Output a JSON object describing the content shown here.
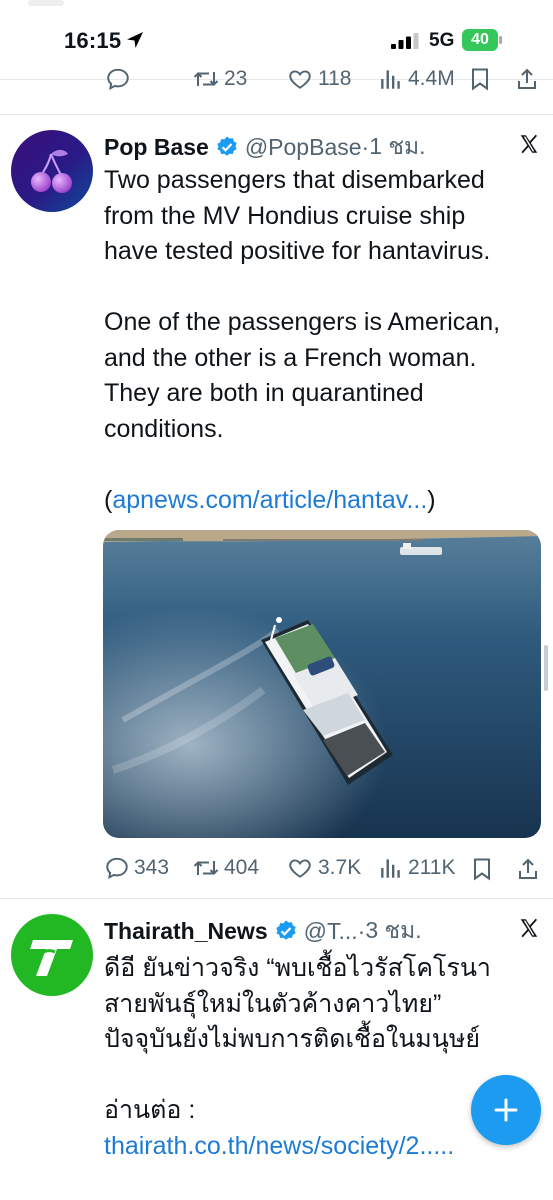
{
  "status_bar": {
    "time": "16:15",
    "network": "5G",
    "battery": "40"
  },
  "prev_tweet_actions": {
    "reposts": "23",
    "likes": "118",
    "views": "4.4M"
  },
  "tweets": [
    {
      "name": "Pop Base",
      "handle": "@PopBase",
      "time": "1 ชม.",
      "text_lines": [
        "Two passengers that disembarked",
        "from the MV Hondius cruise ship",
        "have tested positive for hantavirus.",
        "",
        "One of the passengers is American,",
        "and the other is a French woman.",
        "They are both in quarantined",
        "conditions."
      ],
      "link_prefix": "(",
      "link": "apnews.com/article/hantav...",
      "link_suffix": ")",
      "actions": {
        "replies": "343",
        "reposts": "404",
        "likes": "3.7K",
        "views": "211K"
      }
    },
    {
      "name": "Thairath_News",
      "handle": "@T...",
      "time": "3 ชม.",
      "text_lines": [
        "ดีอี ยันข่าวจริง “พบเชื้อไวรัสโคโรนา",
        "สายพันธุ์ใหม่ในตัวค้างคาวไทย”",
        "ปัจจุบันยังไม่พบการติดเชื้อในมนุษย์",
        "",
        "อ่านต่อ :"
      ],
      "link": "thairath.co.th/news/society/2....."
    }
  ],
  "colors": {
    "link": "#1d7bd6",
    "verified": "#1d9bf0",
    "thairath_green": "#21b823",
    "fab": "#1d9bf0"
  }
}
